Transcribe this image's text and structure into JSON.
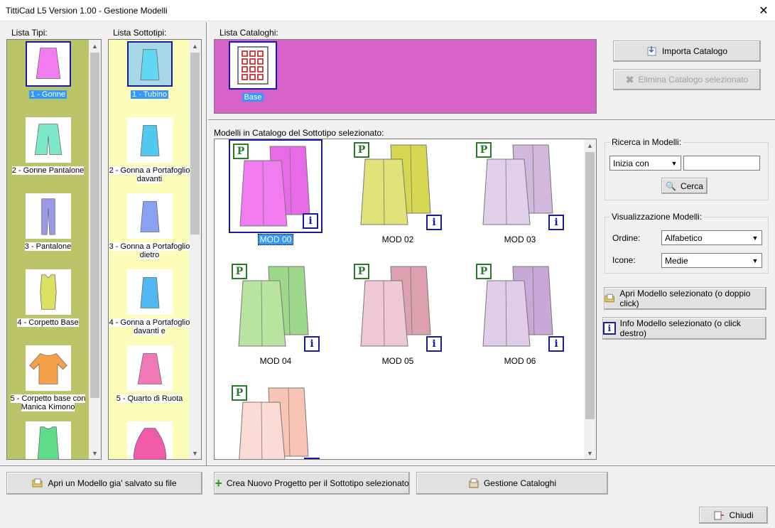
{
  "window": {
    "title": "TittiCad L5 Version 1.00 - Gestione Modelli",
    "close_glyph": "✕"
  },
  "tipi": {
    "label": "Lista Tipi:",
    "items": [
      {
        "label": "1 - Gonne",
        "color": "#f07cf0"
      },
      {
        "label": "2 - Gonne Pantalone",
        "color": "#7de8c8"
      },
      {
        "label": "3 - Pantalone",
        "color": "#9a9ae8"
      },
      {
        "label": "4 - Corpetto Base",
        "color": "#dde060"
      },
      {
        "label": "5 - Corpetto base con Manica Kimono",
        "color": "#f4a04a"
      },
      {
        "label": "",
        "color": "#5edc8a"
      }
    ]
  },
  "sottotipi": {
    "label": "Lista Sottotipi:",
    "items": [
      {
        "label": "1 - Tubino",
        "color": "#60d8f0"
      },
      {
        "label": "2 - Gonna a Portafoglio davanti",
        "color": "#50c8f0"
      },
      {
        "label": "3 - Gonna a Portafoglio dietro",
        "color": "#8aa0f0"
      },
      {
        "label": "4 - Gonna a Portafoglio davanti e",
        "color": "#50b8f0"
      },
      {
        "label": "5 - Quarto di Ruota",
        "color": "#f078b8"
      },
      {
        "label": "",
        "color": "#f05aa8"
      }
    ]
  },
  "cataloghi": {
    "label": "Lista Cataloghi:",
    "items": [
      {
        "label": "Base"
      }
    ],
    "bg": "#d462c8"
  },
  "buttons": {
    "importa": "Importa Catalogo",
    "elimina": "Elimina Catalogo selezionato",
    "cerca": "Cerca",
    "apri_modello": "Apri Modello selezionato (o doppio click)",
    "info_modello": "Info Modello selezionato (o click destro)",
    "apri_file": "Apri un Modello gia' salvato su file",
    "crea_progetto": "Crea Nuovo Progetto per il Sottotipo selezionato",
    "gestione": "Gestione Cataloghi",
    "chiudi": "Chiudi"
  },
  "modelli": {
    "label": "Modelli in Catalogo del Sottotipo selezionato:",
    "badge_p": "P",
    "badge_i": "i",
    "items": [
      {
        "label": "MOD 00",
        "front": "#f07cf0",
        "back": "#e86ae8"
      },
      {
        "label": "MOD 02",
        "front": "#e2e27a",
        "back": "#d6d650"
      },
      {
        "label": "MOD 03",
        "front": "#e2d0ea",
        "back": "#d2b8dc"
      },
      {
        "label": "MOD 04",
        "front": "#b8e4a0",
        "back": "#9ed88a"
      },
      {
        "label": "MOD 05",
        "front": "#eec8d4",
        "back": "#dca0b0"
      },
      {
        "label": "MOD 06",
        "front": "#e2cce8",
        "back": "#c8a8d6"
      },
      {
        "label": "",
        "front": "#fadcd4",
        "back": "#fac4b4"
      }
    ]
  },
  "ricerca": {
    "label": "Ricerca in Modelli:",
    "mode": "Inizia con",
    "text": ""
  },
  "visualizzazione": {
    "label": "Visualizzazione Modelli:",
    "ordine_label": "Ordine:",
    "ordine_value": "Alfabetico",
    "icone_label": "Icone:",
    "icone_value": "Medie"
  }
}
